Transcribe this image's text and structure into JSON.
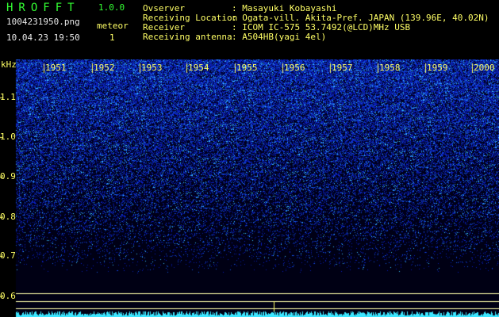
{
  "app": {
    "logo": "HROFFT",
    "version": "1.0.0"
  },
  "file": {
    "name": "1004231950.png",
    "datetime": "10.04.23 19:50"
  },
  "meteor": {
    "label": "meteor",
    "count": "1"
  },
  "info": {
    "observer_label": "Ovserver",
    "observer_value": ": Masayuki Kobayashi",
    "location_label": "Receiving Location",
    "location_value": ": Ogata-vill. Akita-Pref. JAPAN (139.96E, 40.02N)",
    "receiver_label": "Receiver",
    "receiver_value": ": ICOM IC-575 53.7492(@LCD)MHz USB",
    "antenna_label": "Receiving antenna",
    "antenna_value": ": A504HB(yagi 4el)"
  },
  "axis": {
    "unit": "kHz",
    "y_ticks": [
      "1.1",
      "1.0",
      "0.9",
      "0.8",
      "0.7",
      "0.6"
    ],
    "x_ticks": [
      "1951",
      "1952",
      "1953",
      "1954",
      "1955",
      "1956",
      "1957",
      "1958",
      "1959",
      "2000"
    ]
  },
  "colors": {
    "background": "#000000",
    "label_yellow": "#ffff66",
    "title_green": "#33ff33"
  }
}
